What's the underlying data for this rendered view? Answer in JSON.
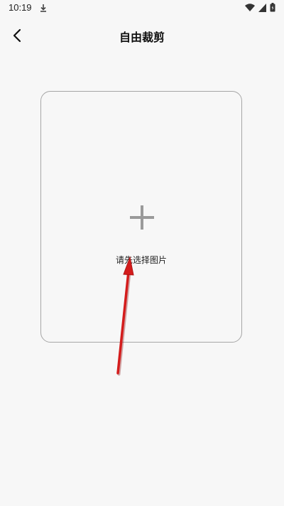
{
  "status_bar": {
    "time": "10:19",
    "icons": [
      "download-icon",
      "wifi-icon",
      "signal-icon",
      "battery-icon"
    ]
  },
  "app_bar": {
    "title": "自由裁剪",
    "back_icon": "chevron-left-icon"
  },
  "picker": {
    "plus_icon": "plus-icon",
    "label": "请先选择图片"
  },
  "colors": {
    "background": "#f7f7f7",
    "picker_border": "#a6a6a6",
    "plus": "#9a9a9a",
    "annotation_arrow": "#d41c1c"
  }
}
